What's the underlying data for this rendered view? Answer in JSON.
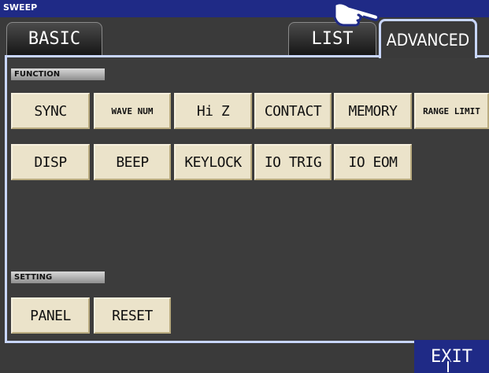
{
  "window": {
    "title": "SWEEP"
  },
  "tabs": {
    "basic": "BASIC",
    "list": "LIST",
    "advanced": "ADVANCED"
  },
  "function": {
    "label": "FUNCTION",
    "buttons": [
      "SYNC",
      "WAVE NUM",
      "Hi Z",
      "CONTACT",
      "MEMORY",
      "RANGE LIMIT",
      "DISP",
      "BEEP",
      "KEYLOCK",
      "IO TRIG",
      "IO EOM"
    ]
  },
  "setting": {
    "label": "SETTING",
    "buttons": [
      "PANEL",
      "RESET"
    ]
  },
  "footer": {
    "exit": "EXIT"
  },
  "colors": {
    "titlebar": "#1f2a86",
    "button_face": "#ebe3ca",
    "frame": "#c8d6ff",
    "background": "#3a3a3a"
  },
  "icons": [
    "pointing-hand-icon"
  ]
}
